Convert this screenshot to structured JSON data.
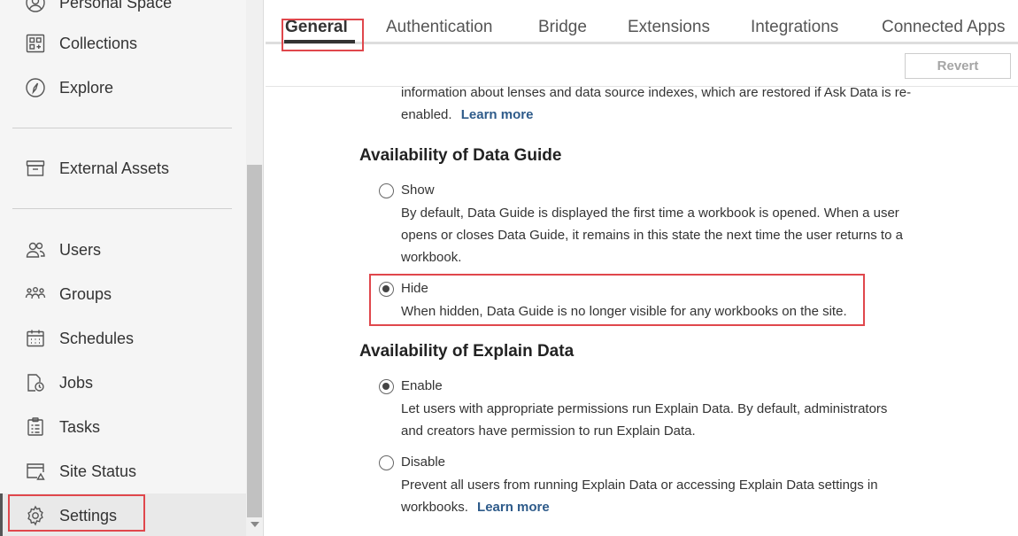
{
  "sidebar": {
    "items": [
      {
        "label": "Personal Space",
        "icon": "user-circle-icon"
      },
      {
        "label": "Collections",
        "icon": "collections-icon"
      },
      {
        "label": "Explore",
        "icon": "compass-icon"
      },
      {
        "label": "External Assets",
        "icon": "archive-box-icon"
      },
      {
        "label": "Users",
        "icon": "users-icon"
      },
      {
        "label": "Groups",
        "icon": "groups-icon"
      },
      {
        "label": "Schedules",
        "icon": "calendar-icon"
      },
      {
        "label": "Jobs",
        "icon": "document-clock-icon"
      },
      {
        "label": "Tasks",
        "icon": "clipboard-icon"
      },
      {
        "label": "Site Status",
        "icon": "window-chart-icon"
      },
      {
        "label": "Settings",
        "icon": "gear-icon",
        "active": true
      }
    ]
  },
  "tabs": [
    {
      "label": "General",
      "active": true
    },
    {
      "label": "Authentication"
    },
    {
      "label": "Bridge"
    },
    {
      "label": "Extensions"
    },
    {
      "label": "Integrations"
    },
    {
      "label": "Connected Apps"
    }
  ],
  "toolbar": {
    "revert_label": "Revert"
  },
  "ask_data_fragment": {
    "line1": "information about lenses and data source indexes, which are restored if Ask Data is re-",
    "line2": "enabled.",
    "learn_more": "Learn more"
  },
  "data_guide": {
    "title": "Availability of Data Guide",
    "show": {
      "label": "Show",
      "checked": false,
      "desc_lines": [
        "By default, Data Guide is displayed the first time a workbook is opened. When a user",
        "opens or closes Data Guide, it remains in this state the next time the user returns to a",
        "workbook."
      ]
    },
    "hide": {
      "label": "Hide",
      "checked": true,
      "desc": "When hidden, Data Guide is no longer visible for any workbooks on the site."
    }
  },
  "explain_data": {
    "title": "Availability of Explain Data",
    "enable": {
      "label": "Enable",
      "checked": true,
      "desc_lines": [
        "Let users with appropriate permissions run Explain Data. By default, administrators",
        "and creators have permission to run Explain Data."
      ]
    },
    "disable": {
      "label": "Disable",
      "checked": false,
      "desc_line1": "Prevent all users from running Explain Data or accessing Explain Data settings in",
      "desc_line2": "workbooks.",
      "learn_more": "Learn more"
    }
  },
  "colors": {
    "highlight": "#e0474c",
    "link": "#2e5b8a",
    "sidebar_bg": "#f5f5f5"
  }
}
